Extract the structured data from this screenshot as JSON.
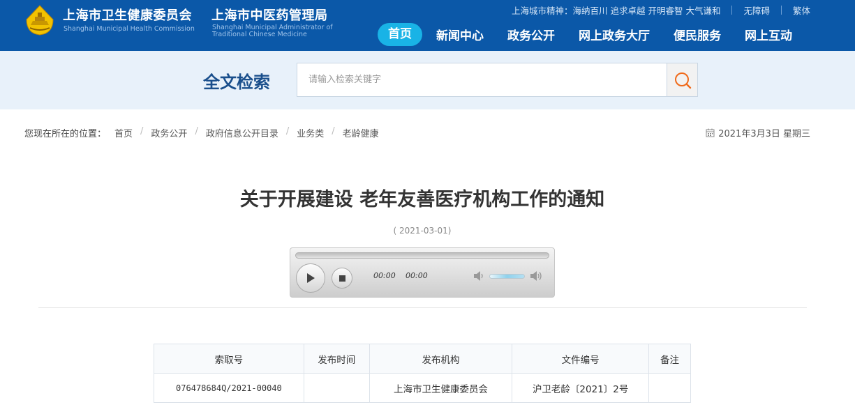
{
  "header": {
    "org1_cn": "上海市卫生健康委员会",
    "org1_en": "Shanghai Municipal Health Commission",
    "org2_cn": "上海市中医药管理局",
    "org2_en": "Shanghai Municipal Administrator of Traditional Chinese Medicine",
    "city_spirit": "上海城市精神：海纳百川 追求卓越 开明睿智 大气谦和",
    "accessibility_link": "无障碍",
    "traditional_link": "繁体",
    "nav": [
      "首页",
      "新闻中心",
      "政务公开",
      "网上政务大厅",
      "便民服务",
      "网上互动"
    ],
    "active_nav": "首页",
    "colors": {
      "bar": "#0b58a8",
      "active_tab": "#19b3e6"
    }
  },
  "search": {
    "title": "全文检索",
    "placeholder": "请输入检索关键字",
    "button_icon": "search-icon"
  },
  "breadcrumb": {
    "prefix": "您现在所在的位置：",
    "items": [
      "首页",
      "政务公开",
      "政府信息公开目录",
      "业务类",
      "老龄健康"
    ]
  },
  "today": "2021年3月3日 星期三",
  "article": {
    "title": "关于开展建设 老年友善医疗机构工作的通知",
    "date": "( 2021-03-01)"
  },
  "player": {
    "current_time": "00:00",
    "duration": "00:00",
    "progress": 0,
    "volume": 0.8
  },
  "info_table": {
    "headers": [
      "索取号",
      "发布时间",
      "发布机构",
      "文件编号",
      "备注"
    ],
    "rows": [
      [
        "076478684Q/2021-00040",
        "",
        "上海市卫生健康委员会",
        "沪卫老龄〔2021〕2号",
        ""
      ]
    ]
  }
}
